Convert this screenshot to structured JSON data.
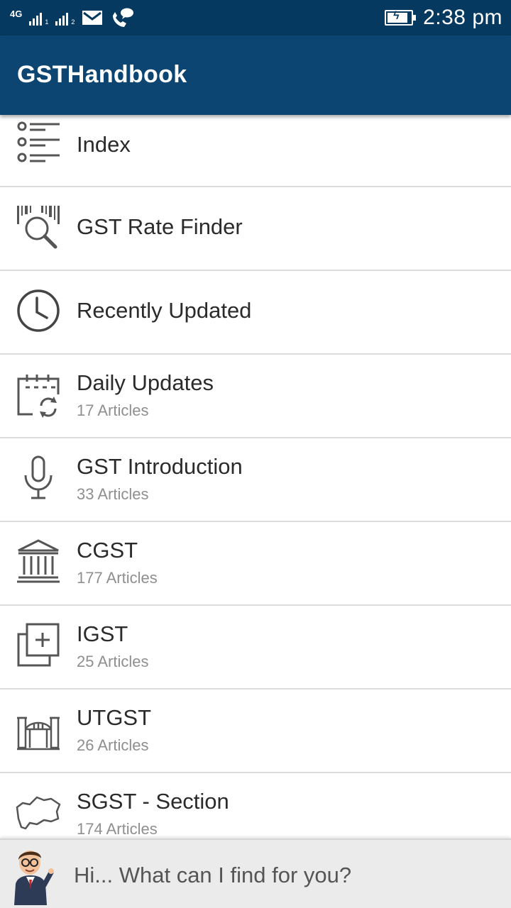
{
  "status_bar": {
    "network_label": "4G",
    "sim1_index": "1",
    "sim2_index": "2",
    "icons": [
      "signal-sim1-icon",
      "signal-sim2-icon",
      "gmail-icon",
      "call-message-icon",
      "battery-charging-icon"
    ],
    "time": "2:38 pm"
  },
  "app_bar": {
    "title": "GSTHandbook"
  },
  "menu": {
    "items": [
      {
        "title": "Index",
        "subtitle": "",
        "icon": "list-index-icon"
      },
      {
        "title": "GST Rate Finder",
        "subtitle": "",
        "icon": "barcode-search-icon"
      },
      {
        "title": "Recently Updated",
        "subtitle": "",
        "icon": "clock-icon"
      },
      {
        "title": "Daily Updates",
        "subtitle": "17 Articles",
        "icon": "calendar-refresh-icon"
      },
      {
        "title": "GST Introduction",
        "subtitle": "33 Articles",
        "icon": "microphone-icon"
      },
      {
        "title": "CGST",
        "subtitle": "177 Articles",
        "icon": "government-building-icon"
      },
      {
        "title": "IGST",
        "subtitle": "25 Articles",
        "icon": "add-layers-icon"
      },
      {
        "title": "UTGST",
        "subtitle": "26 Articles",
        "icon": "gateway-monument-icon"
      },
      {
        "title": "SGST - Section",
        "subtitle": "174 Articles",
        "icon": "state-map-icon"
      }
    ]
  },
  "assistant": {
    "prompt": "Hi... What can I find for you?",
    "avatar_icon": "assistant-avatar-icon"
  },
  "colors": {
    "status_bar": "#06395f",
    "app_bar": "#0c4571",
    "divider": "#dcdcdc",
    "subtitle_text": "#8f8f8f",
    "assistant_bg": "#ebebeb"
  }
}
